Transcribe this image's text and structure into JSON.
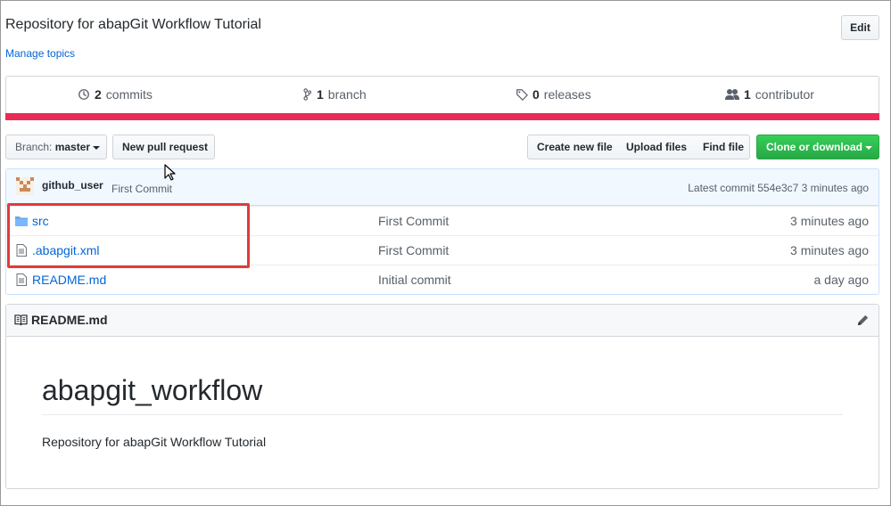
{
  "repo": {
    "description": "Repository for abapGit Workflow Tutorial",
    "manage_topics": "Manage topics",
    "edit_label": "Edit"
  },
  "summary": {
    "commits_count": "2",
    "commits_label": "commits",
    "branch_count": "1",
    "branch_label": "branch",
    "releases_count": "0",
    "releases_label": "releases",
    "contributors_count": "1",
    "contributors_label": "contributor",
    "language_color": "#ea2b57"
  },
  "toolbar": {
    "branch_prefix": "Branch:",
    "branch_name": "master",
    "new_pr": "New pull request",
    "create_file": "Create new file",
    "upload_files": "Upload files",
    "find_file": "Find file",
    "clone": "Clone or download"
  },
  "commit": {
    "user": "github_user",
    "message": "First Commit",
    "latest": "Latest commit 554e3c7 3 minutes ago"
  },
  "files": [
    {
      "name": "src",
      "icon": "folder-icon",
      "message": "First Commit",
      "age": "3 minutes ago"
    },
    {
      "name": ".abapgit.xml",
      "icon": "file-icon",
      "message": "First Commit",
      "age": "3 minutes ago"
    },
    {
      "name": "README.md",
      "icon": "file-icon",
      "message": "Initial commit",
      "age": "a day ago"
    }
  ],
  "readme": {
    "filename": "README.md",
    "heading": "abapgit_workflow",
    "body": "Repository for abapGit Workflow Tutorial"
  }
}
